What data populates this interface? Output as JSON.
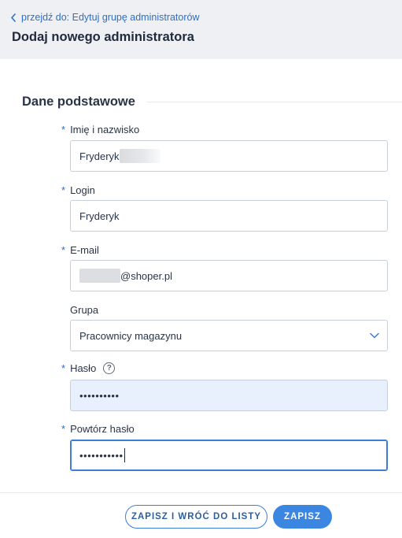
{
  "header": {
    "back_link": "przejdź do: Edytuj grupę administratorów",
    "title": "Dodaj nowego administratora"
  },
  "section": {
    "title": "Dane podstawowe"
  },
  "form": {
    "required_mark": "*",
    "full_name": {
      "label": "Imię i nazwisko",
      "value": "Fryderyk"
    },
    "login": {
      "label": "Login",
      "value": "Fryderyk"
    },
    "email": {
      "label": "E-mail",
      "value": "@shoper.pl"
    },
    "group": {
      "label": "Grupa",
      "value": "Pracownicy magazynu"
    },
    "password": {
      "label": "Hasło",
      "value": "••••••••••",
      "help": "?"
    },
    "repeat_password": {
      "label": "Powtórz hasło",
      "value": "•••••••••••"
    }
  },
  "actions": {
    "save_and_back": "ZAPISZ I WRÓĆ DO LISTY",
    "save": "ZAPISZ"
  },
  "colors": {
    "accent": "#3b86e0",
    "header_bg": "#eef0f4",
    "autofill_bg": "#e8f0fe"
  }
}
